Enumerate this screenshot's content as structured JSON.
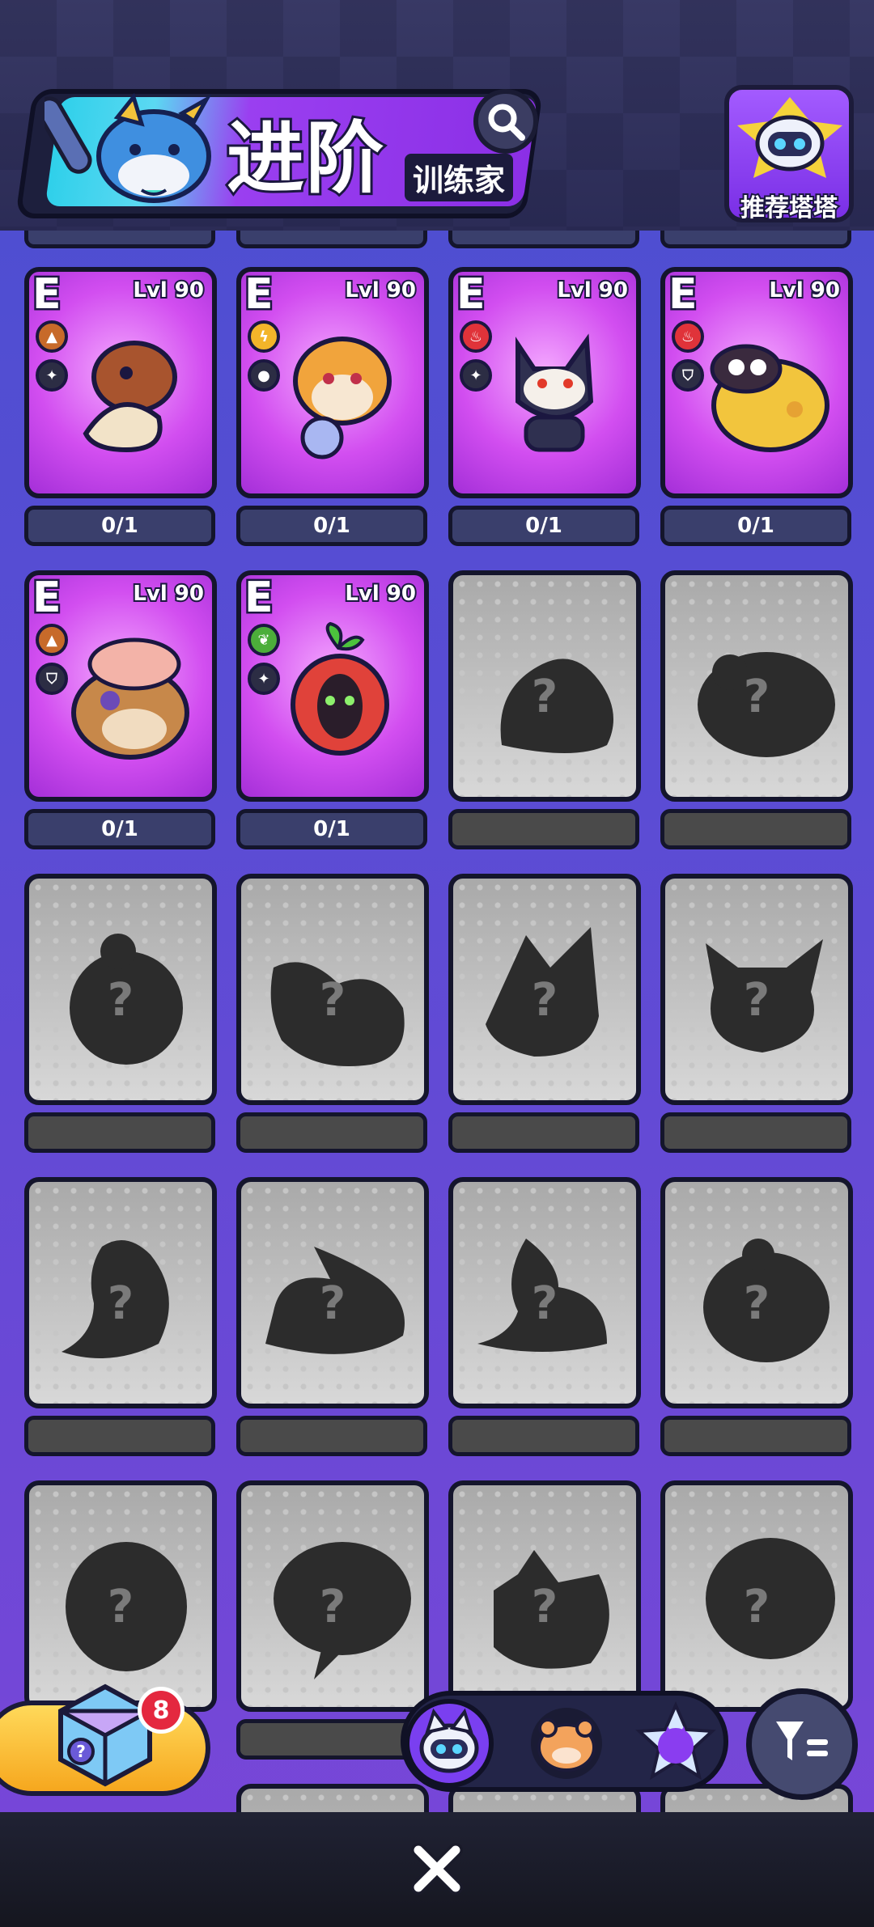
{
  "header": {
    "title_main": "进阶",
    "title_sub": "训练家",
    "recommend_label": "推荐塔塔"
  },
  "cards": [
    {
      "grade": "E",
      "level": "Lvl 90",
      "progress": "0/1",
      "known": true,
      "color": "#b1412a"
    },
    {
      "grade": "E",
      "level": "Lvl 90",
      "progress": "0/1",
      "known": true,
      "color": "#f1a43c"
    },
    {
      "grade": "E",
      "level": "Lvl 90",
      "progress": "0/1",
      "known": true,
      "color": "#2f3050"
    },
    {
      "grade": "E",
      "level": "Lvl 90",
      "progress": "0/1",
      "known": true,
      "color": "#f2c53d"
    },
    {
      "grade": "E",
      "level": "Lvl 90",
      "progress": "0/1",
      "known": true,
      "color": "#c7884a"
    },
    {
      "grade": "E",
      "level": "Lvl 90",
      "progress": "0/1",
      "known": true,
      "color": "#e0423a"
    }
  ],
  "unknown_mark": "?",
  "shop": {
    "count": "8"
  },
  "colors": {
    "accent": "#8b2fe6",
    "card_purple": "#d24ef0",
    "badge_red": "#e4283f"
  }
}
